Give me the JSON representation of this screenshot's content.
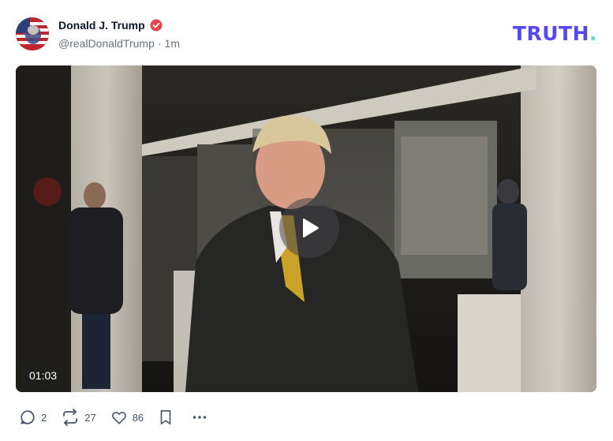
{
  "post": {
    "author": {
      "display_name": "Donald J. Trump",
      "handle": "@realDonaldTrump",
      "separator": "·",
      "time_ago": "1m",
      "verified": true,
      "badge_color": "#e5484d"
    },
    "brand": {
      "logo_text": "TRUTH",
      "logo_dot": ".",
      "logo_color": "#5448ee",
      "dot_color": "#5ce0c9"
    },
    "media": {
      "type": "video",
      "duration": "01:03",
      "play_icon": "play-icon"
    },
    "actions": {
      "replies": {
        "icon": "reply-icon",
        "count": "2"
      },
      "retruths": {
        "icon": "retruth-icon",
        "count": "27"
      },
      "likes": {
        "icon": "heart-icon",
        "count": "86"
      },
      "bookmark": {
        "icon": "bookmark-icon"
      },
      "more": {
        "icon": "more-icon"
      }
    }
  }
}
